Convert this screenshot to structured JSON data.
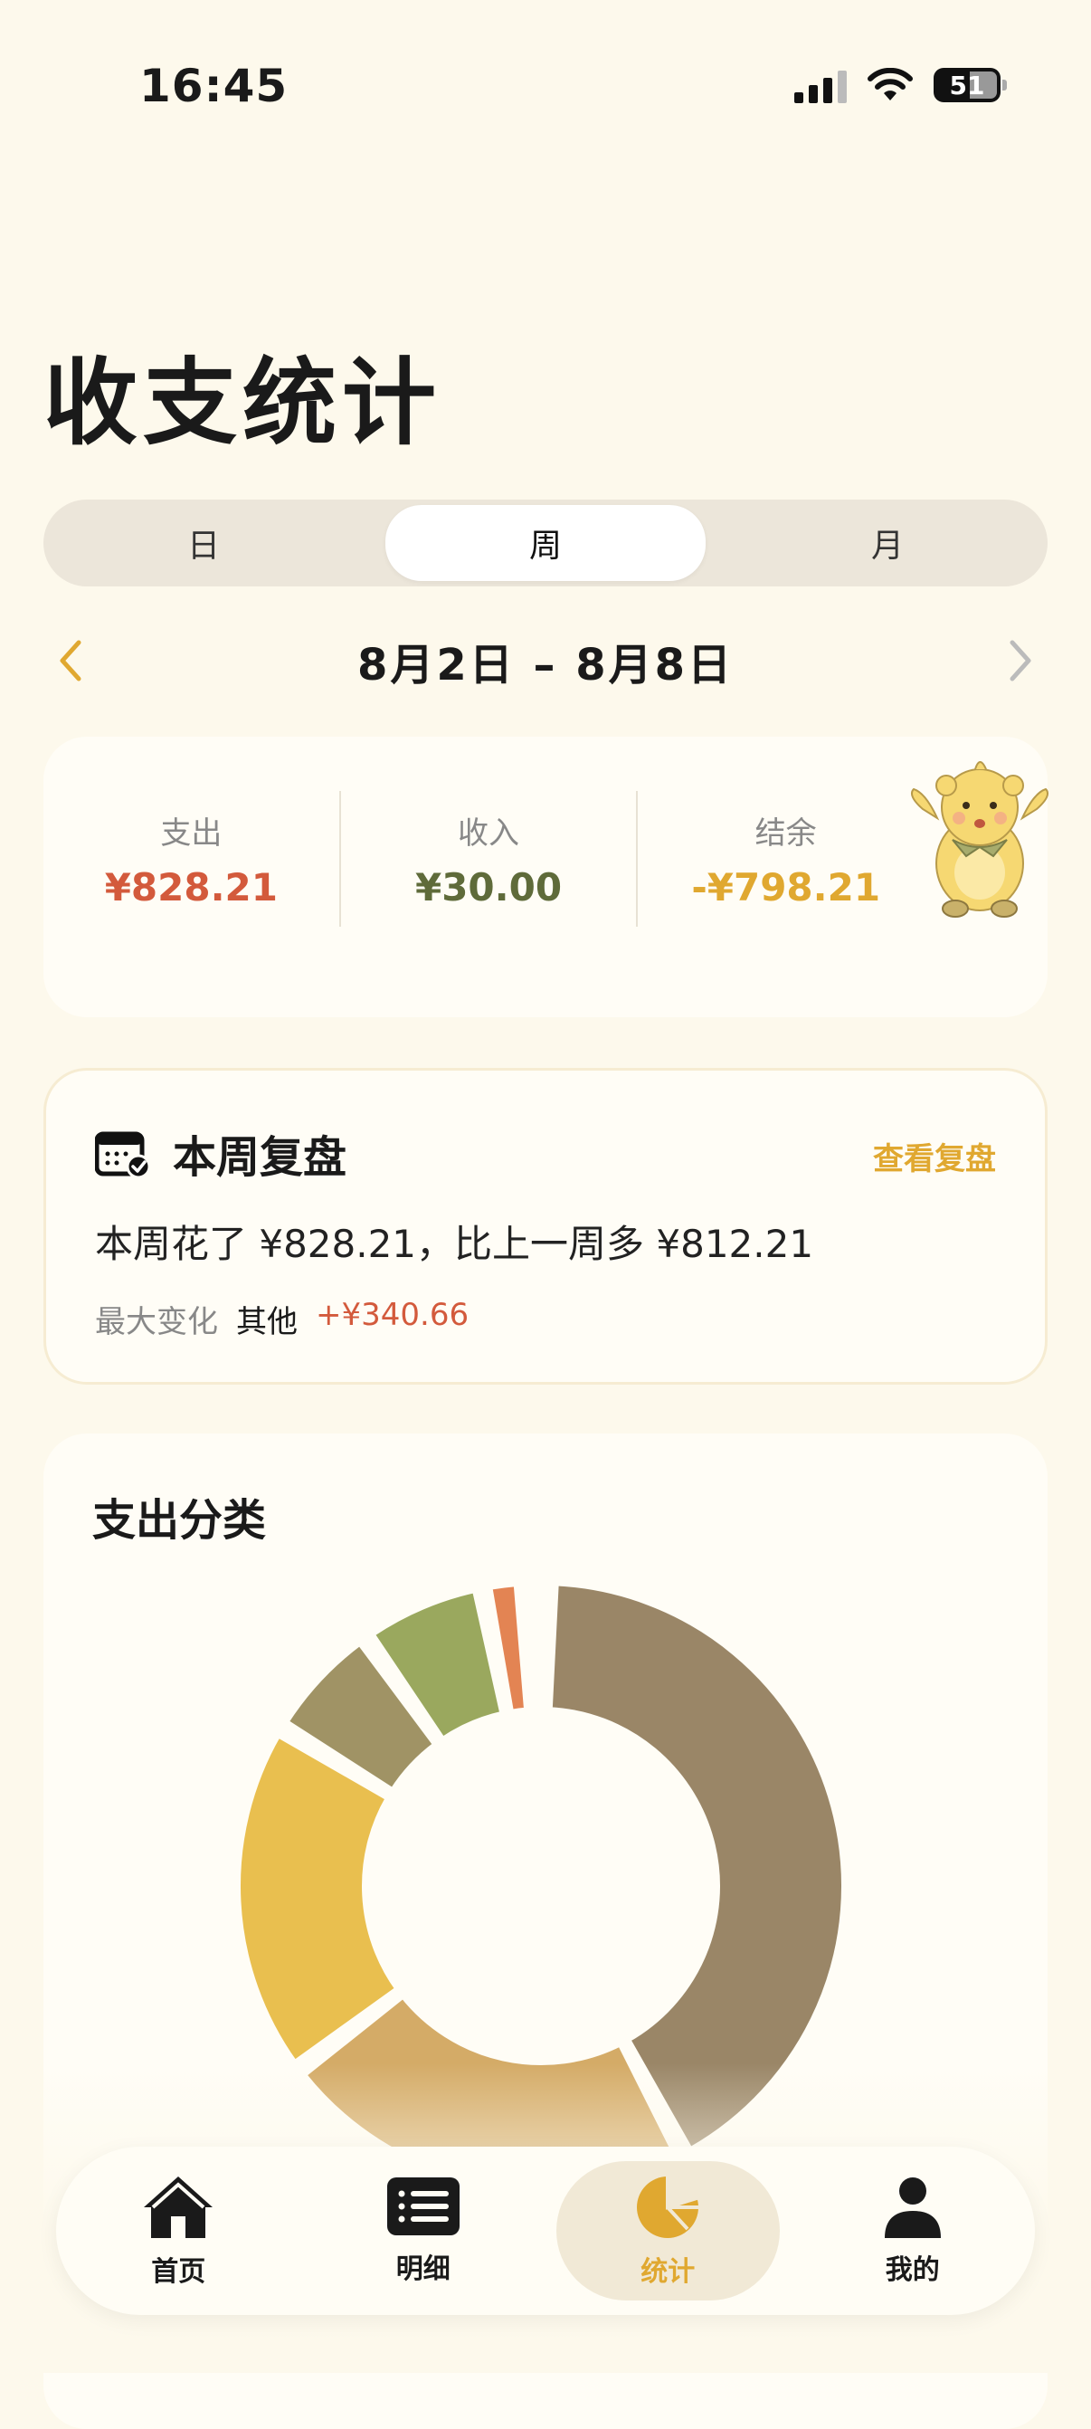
{
  "status": {
    "time": "16:45",
    "battery": "51"
  },
  "page": {
    "title": "收支统计"
  },
  "period_tabs": [
    {
      "label": "日"
    },
    {
      "label": "周"
    },
    {
      "label": "月"
    }
  ],
  "date_nav": {
    "range": "8月2日 – 8月8日"
  },
  "summary": {
    "expense": {
      "label": "支出",
      "value": "¥828.21",
      "color": "#d35a3c"
    },
    "income": {
      "label": "收入",
      "value": "¥30.00",
      "color": "#5f6b3a"
    },
    "balance": {
      "label": "结余",
      "value": "-¥798.21",
      "color": "#e0a830"
    }
  },
  "review": {
    "title": "本周复盘",
    "link": "查看复盘",
    "text": "本周花了 ¥828.21，比上一周多 ¥812.21",
    "meta_label": "最大变化",
    "meta_category": "其他",
    "meta_value": "+¥340.66"
  },
  "category": {
    "title": "支出分类",
    "segments": [
      {
        "color": "#9a8667",
        "share": 0.418
      },
      {
        "color": "#d4ab67",
        "share": 0.225
      },
      {
        "color": "#e9bf4f",
        "share": 0.19
      },
      {
        "color": "#a09365",
        "share": 0.065
      },
      {
        "color": "#9aa85e",
        "share": 0.067
      },
      {
        "color": "#e38453",
        "share": 0.022
      }
    ]
  },
  "tabbar": [
    {
      "label": "首页",
      "icon": "home-icon"
    },
    {
      "label": "明细",
      "icon": "list-icon"
    },
    {
      "label": "统计",
      "icon": "pie-chart-icon"
    },
    {
      "label": "我的",
      "icon": "person-icon"
    }
  ]
}
